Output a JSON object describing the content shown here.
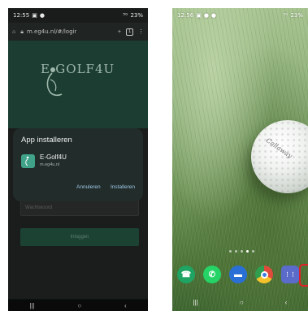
{
  "left_phone": {
    "status": {
      "time": "12:55",
      "signal": "⁵ᴳ",
      "battery": "23%"
    },
    "url_bar": {
      "url": "m.eg4u.nl/#/logir",
      "tab_count": "1"
    },
    "logo_text": "E-GOLF4U",
    "dialog": {
      "title": "App installeren",
      "app_name": "E-Golf4U",
      "app_url": "m.eg4u.nl",
      "cancel_label": "Annuleren",
      "install_label": "Installeren"
    },
    "password_placeholder": "Wachtwoord",
    "login_label": "Inloggen",
    "nav": {
      "recent": "|||",
      "home": "○",
      "back": "‹"
    }
  },
  "right_phone": {
    "status": {
      "time": "12:56",
      "signal": "⁵ᴳ",
      "battery": "23%"
    },
    "ball_brand": "Callaway",
    "dock_apps": [
      {
        "name": "phone-icon",
        "glyph": "☎",
        "color": "#1fa463"
      },
      {
        "name": "whatsapp-icon",
        "glyph": "✆",
        "color": "#25d366"
      },
      {
        "name": "messages-icon",
        "glyph": "▬",
        "color": "#2a6fd6"
      },
      {
        "name": "chrome-icon",
        "glyph": "◉",
        "color": "#e04a3a"
      },
      {
        "name": "app-drawer-icon",
        "glyph": "⋮⋮",
        "color": "#5a6bc9"
      }
    ],
    "nav": {
      "recent": "|||",
      "home": "○",
      "back": "‹"
    },
    "highlight_color": "#e2202a"
  }
}
